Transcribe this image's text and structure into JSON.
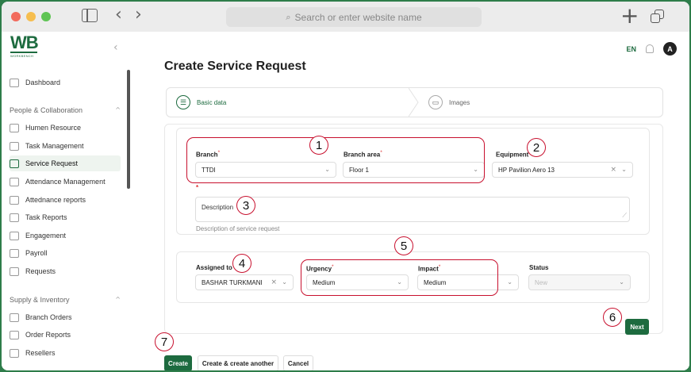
{
  "browser": {
    "url_placeholder": "Search or enter website name"
  },
  "header": {
    "logo_text": "WB",
    "logo_subtext": "WORKBENCH",
    "language": "EN",
    "avatar_initial": "A"
  },
  "sidebar": {
    "items": [
      {
        "label": "Dashboard"
      },
      {
        "label": "Humen Resource"
      },
      {
        "label": "Task Management"
      },
      {
        "label": "Service Request",
        "active": true
      },
      {
        "label": "Attendance Management"
      },
      {
        "label": "Attednance reports"
      },
      {
        "label": "Task Reports"
      },
      {
        "label": "Engagement"
      },
      {
        "label": "Payroll"
      },
      {
        "label": "Requests"
      },
      {
        "label": "Branch Orders"
      },
      {
        "label": "Order Reports"
      },
      {
        "label": "Resellers"
      }
    ],
    "sections": [
      {
        "label": "People & Collaboration"
      },
      {
        "label": "Supply & Inventory"
      }
    ]
  },
  "page": {
    "title": "Create Service Request"
  },
  "steps": [
    {
      "label": "Basic data",
      "state": "active",
      "icon": "list-icon"
    },
    {
      "label": "Images",
      "state": "inactive",
      "icon": "image-icon"
    }
  ],
  "form": {
    "branch": {
      "label": "Branch",
      "value": "TTDI"
    },
    "branch_area": {
      "label": "Branch area",
      "value": "Floor 1"
    },
    "equipment": {
      "label": "Equipment",
      "value": "HP Pavilion Aero 13"
    },
    "description": {
      "placeholder": "Description",
      "help": "Description of service request"
    },
    "assigned_to": {
      "label": "Assigned to",
      "value": "BASHAR TURKMANI"
    },
    "urgency": {
      "label": "Urgency",
      "value": "Medium"
    },
    "impact": {
      "label": "Impact",
      "value": "Medium"
    },
    "status": {
      "label": "Status",
      "value": "New"
    },
    "required_mark": "*"
  },
  "buttons": {
    "next": "Next",
    "create": "Create",
    "create_another": "Create & create another",
    "cancel": "Cancel"
  },
  "annotations": [
    "1",
    "2",
    "3",
    "4",
    "5",
    "6",
    "7"
  ],
  "colors": {
    "brand": "#1d6b3f",
    "annotation": "#c8102e"
  }
}
